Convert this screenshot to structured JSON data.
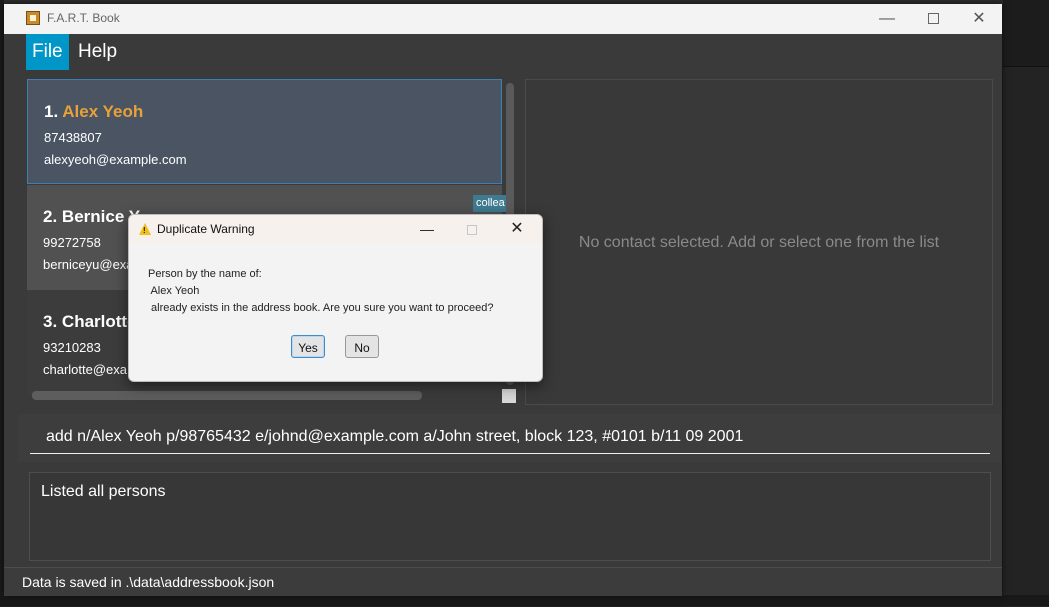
{
  "window": {
    "title": "F.A.R.T. Book"
  },
  "menu": {
    "file": "File",
    "help": "Help"
  },
  "persons": [
    {
      "index": "1.",
      "name": "Alex Yeoh",
      "phone": "87438807",
      "email": "alexyeoh@example.com",
      "tag": ""
    },
    {
      "index": "2.",
      "name": "Bernice Y",
      "phone": "99272758",
      "email": "berniceyu@exa",
      "tag": "collea"
    },
    {
      "index": "3.",
      "name": "Charlotte",
      "phone": "93210283",
      "email": "charlotte@exa",
      "tag": ""
    }
  ],
  "detail": {
    "placeholder": "No contact selected. Add or select one from the list"
  },
  "command": {
    "value": "add n/Alex Yeoh p/98765432 e/johnd@example.com a/John street, block 123, #0101 b/11 09 2001"
  },
  "result": {
    "text": "Listed all persons"
  },
  "status": {
    "text": "Data is saved in .\\data\\addressbook.json"
  },
  "dialog": {
    "title": "Duplicate Warning",
    "line1": "Person by the name of:",
    "line2": " Alex Yeoh",
    "line3": " already exists in the address book. Are you sure you want to proceed?",
    "yes": "Yes",
    "no": "No"
  }
}
